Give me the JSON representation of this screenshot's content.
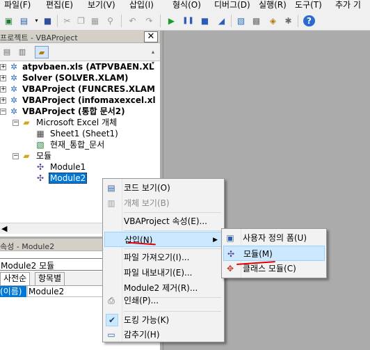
{
  "menubar": {
    "items": [
      "파일(F)",
      "편집(E)",
      "보기(V)",
      "삽입(I)",
      "형식(O)",
      "디버그(D)",
      "실행(R)",
      "도구(T)",
      "추가 기"
    ]
  },
  "project_explorer": {
    "title": "프로젝트 - VBAProject",
    "close_glyph": "✕",
    "tree": [
      {
        "label": "atpvbaen.xls (ATPVBAEN.XL",
        "bold": true
      },
      {
        "label": "Solver (SOLVER.XLAM)",
        "bold": true
      },
      {
        "label": "VBAProject (FUNCRES.XLAM",
        "bold": true
      },
      {
        "label": "VBAProject (infomaxexcel.xl",
        "bold": true
      },
      {
        "label": "VBAProject (통합 문서2)",
        "bold": true
      },
      {
        "label": "Microsoft Excel 개체",
        "bold": false
      },
      {
        "label": "Sheet1 (Sheet1)",
        "bold": false
      },
      {
        "label": "현재_통합_문서",
        "bold": false
      },
      {
        "label": "모듈",
        "bold": false
      },
      {
        "label": "Module1",
        "bold": false
      },
      {
        "label": "Module2",
        "bold": false,
        "selected": true
      }
    ],
    "hscroll_arrow": "◀"
  },
  "properties": {
    "title": "속성 - Module2",
    "combo_value": "Module2 모듈",
    "tabs": [
      "사전순",
      "항목별"
    ],
    "rows": [
      {
        "name": "(이름)",
        "value": "Module2"
      }
    ]
  },
  "context_menu": {
    "items": [
      {
        "label": "코드 보기(O)",
        "icon": "code-icon",
        "disabled": false
      },
      {
        "label": "개체 보기(B)",
        "icon": "object-icon",
        "disabled": true
      },
      {
        "label": "VBAProject 속성(E)...",
        "icon": "",
        "disabled": false
      },
      {
        "label": "삽입(N)",
        "icon": "",
        "disabled": false,
        "submenu": true,
        "highlighted": true
      },
      {
        "label": "파일 가져오기(I)...",
        "icon": "",
        "disabled": false
      },
      {
        "label": "파일 내보내기(E)...",
        "icon": "",
        "disabled": false
      },
      {
        "label": "Module2 제거(R)...",
        "icon": "",
        "disabled": false
      },
      {
        "label": "인쇄(P)...",
        "icon": "print-icon",
        "disabled": false
      },
      {
        "label": "도킹 가능(K)",
        "icon": "check-icon",
        "disabled": false,
        "checked": true
      },
      {
        "label": "감추기(H)",
        "icon": "hide-icon",
        "disabled": false
      }
    ]
  },
  "insert_submenu": {
    "items": [
      {
        "label": "사용자 정의 폼(U)",
        "icon": "userform-icon"
      },
      {
        "label": "모듈(M)",
        "icon": "module-icon",
        "highlighted": true
      },
      {
        "label": "클래스 모듈(C)",
        "icon": "class-module-icon"
      }
    ]
  },
  "colors": {
    "selection": "#0078d7",
    "menu_highlight": "#cce8ff",
    "annotation_red": "#e00000"
  }
}
